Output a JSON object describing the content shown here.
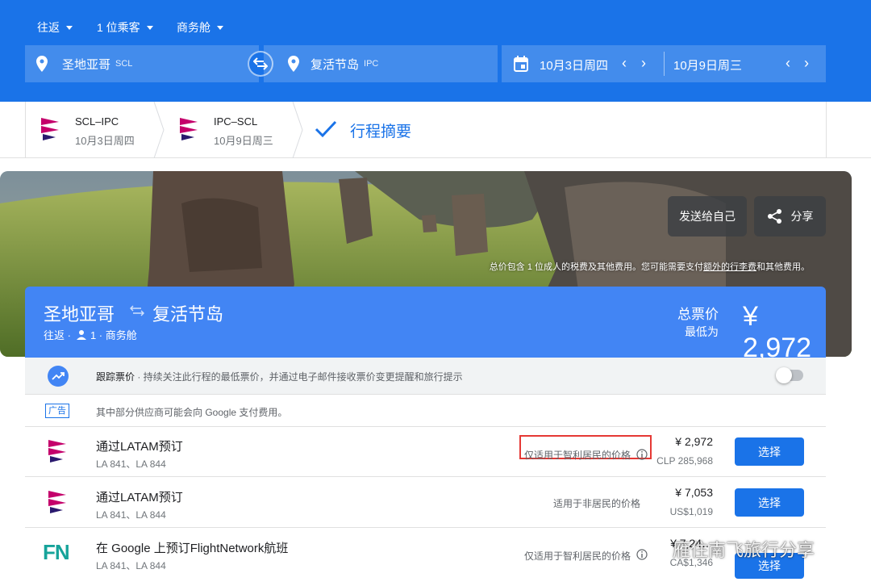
{
  "colors": {
    "brand_blue": "#1a73e8",
    "card_blue": "#4285f4",
    "latam_magenta": "#c4006b",
    "latam_navy": "#2a1a6e",
    "fn_teal": "#16a39a",
    "highlight_red": "#e53935"
  },
  "search": {
    "trip_type": "往返",
    "passengers": "1 位乘客",
    "cabin": "商务舱",
    "origin": {
      "city": "圣地亚哥",
      "code": "SCL"
    },
    "destination": {
      "city": "复活节岛",
      "code": "IPC"
    },
    "depart_date": "10月3日周四",
    "return_date": "10月9日周三"
  },
  "steps": [
    {
      "route": "SCL–IPC",
      "date": "10月3日周四"
    },
    {
      "route": "IPC–SCL",
      "date": "10月9日周三"
    }
  ],
  "summary_step": "行程摘要",
  "hero": {
    "send_label": "发送给自己",
    "share_label": "分享",
    "note_prefix": "总价包含 1 位成人的税费及其他费用。您可能需要支付",
    "note_link": "额外的行李费",
    "note_suffix": "和其他费用。"
  },
  "card": {
    "origin": "圣地亚哥",
    "destination": "复活节岛",
    "trip": "往返 ·",
    "details": "1 · 商务舱",
    "total_label": "总票价",
    "lowest_label": "最低为",
    "price": "¥ 2,972"
  },
  "track": {
    "title": "跟踪票价",
    "text": " · 持续关注此行程的最低票价，并通过电子邮件接收票价变更提醒和旅行提示"
  },
  "ad": {
    "badge": "广告",
    "text": "其中部分供应商可能会向 Google 支付费用。"
  },
  "bookings": [
    {
      "logo": "latam-logo",
      "provider": "通过LATAM预订",
      "flights": "LA 841、LA 844",
      "note": "仅适用于智利居民的价格",
      "price": "¥ 2,972",
      "alt_price": "CLP 285,968",
      "select": "选择"
    },
    {
      "logo": "latam-logo",
      "provider": "通过LATAM预订",
      "flights": "LA 841、LA 844",
      "note": "适用于非居民的价格",
      "price": "¥ 7,053",
      "alt_price": "US$1,019",
      "select": "选择"
    },
    {
      "logo": "fn-logo",
      "logo_text": "FN",
      "provider": "在 Google 上预订FlightNetwork航班",
      "flights": "LA 841、LA 844",
      "note": "仅适用于智利居民的价格",
      "price": "¥ 7,24…",
      "alt_price": "CA$1,346",
      "select": "选择"
    }
  ],
  "watermark": "雁住南飞旅行分享"
}
